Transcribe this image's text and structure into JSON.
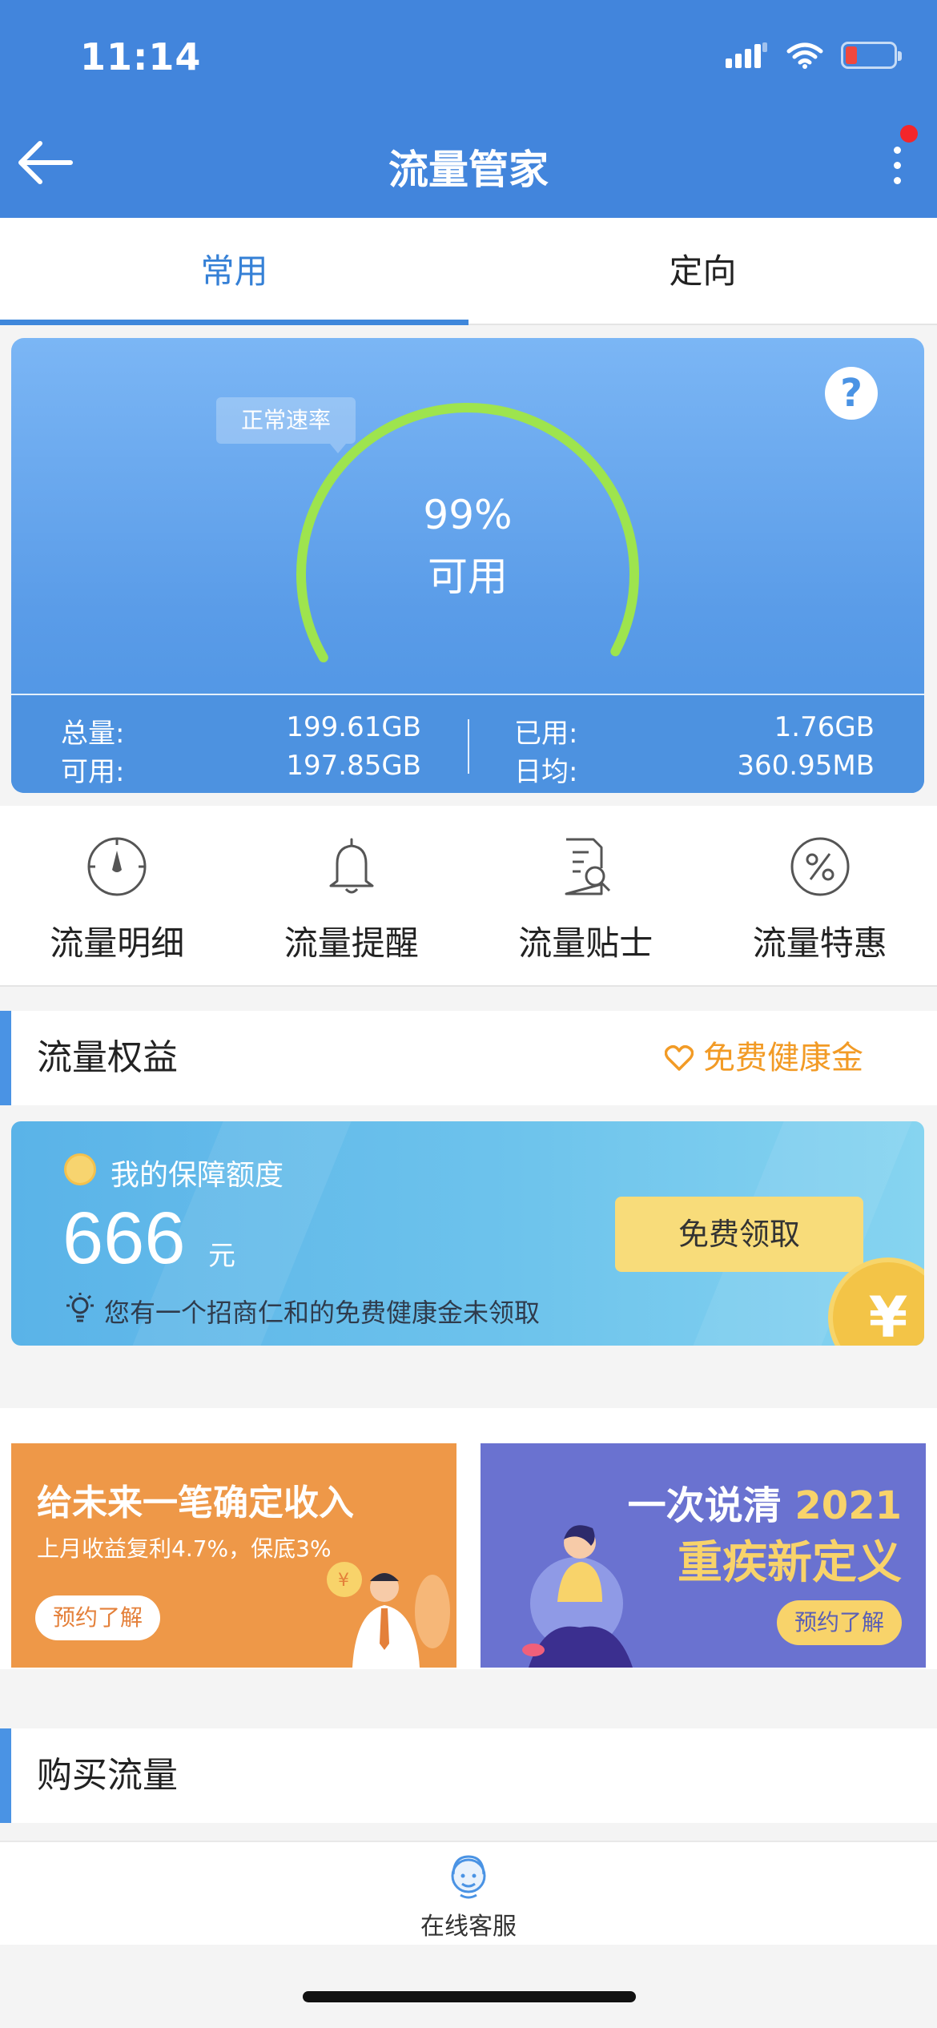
{
  "status_bar": {
    "time": "11:14"
  },
  "header": {
    "title": "流量管家"
  },
  "tabs": [
    {
      "label": "常用",
      "active": true
    },
    {
      "label": "定向",
      "active": false
    }
  ],
  "gauge": {
    "rate_tag": "正常速率",
    "percent": "99%",
    "percent_value": 99,
    "status": "可用",
    "help": "?",
    "stats": {
      "total_label": "总量:",
      "total_value": "199.61GB",
      "available_label": "可用:",
      "available_value": "197.85GB",
      "used_label": "已用:",
      "used_value": "1.76GB",
      "daily_label": "日均:",
      "daily_value": "360.95MB"
    }
  },
  "menu": [
    {
      "label": "流量明细",
      "icon": "compass-icon"
    },
    {
      "label": "流量提醒",
      "icon": "bell-icon"
    },
    {
      "label": "流量贴士",
      "icon": "document-search-icon"
    },
    {
      "label": "流量特惠",
      "icon": "percent-icon"
    }
  ],
  "rights_section": {
    "title": "流量权益",
    "link": "免费健康金"
  },
  "benefit": {
    "subtitle": "我的保障额度",
    "amount": "666",
    "unit": "元",
    "note": "您有一个招商仁和的免费健康金未领取",
    "button": "免费领取",
    "coin_symbol": "¥"
  },
  "banners": {
    "left": {
      "title": "给未来一笔确定收入",
      "subtitle": "上月收益复利4.7%，保底3%",
      "button": "预约了解"
    },
    "right": {
      "title_a": "一次说清",
      "title_year": "2021",
      "title_b": "重疾新定义",
      "button": "预约了解"
    }
  },
  "buy_section": {
    "title": "购买流量"
  },
  "bottom": {
    "service_label": "在线客服"
  },
  "colors": {
    "primary": "#4285dc",
    "accent_orange": "#f29b26",
    "gauge_green": "#9ee44e",
    "button_yellow": "#f8dc7a"
  }
}
